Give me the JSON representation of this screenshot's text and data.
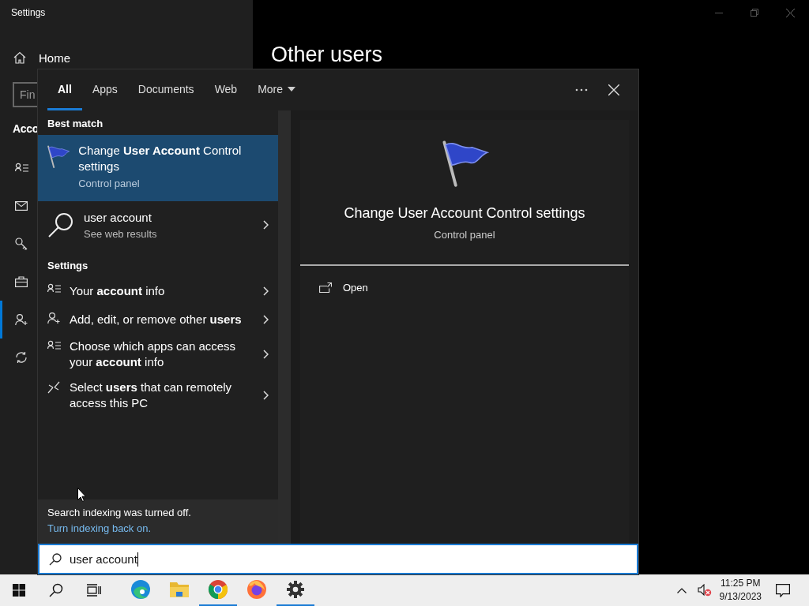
{
  "window": {
    "title": "Settings"
  },
  "sidebar": {
    "home": "Home",
    "search": {
      "placeholder": "Fin"
    },
    "section": "Acco",
    "items": [
      {
        "kind": "contact",
        "selected": false
      },
      {
        "kind": "mail",
        "selected": false
      },
      {
        "kind": "key",
        "selected": false
      },
      {
        "kind": "briefcase",
        "selected": false
      },
      {
        "kind": "person-add",
        "selected": true
      },
      {
        "kind": "sync",
        "selected": false
      }
    ]
  },
  "page": {
    "heading": "Other users"
  },
  "search_flyout": {
    "tabs": [
      {
        "label": "All",
        "selected": true
      },
      {
        "label": "Apps",
        "selected": false
      },
      {
        "label": "Documents",
        "selected": false
      },
      {
        "label": "Web",
        "selected": false
      }
    ],
    "more": "More",
    "best_match_heading": "Best match",
    "best_match": {
      "title": "Change **User Account** Control settings",
      "subtitle": "Control panel",
      "selected": true
    },
    "web_result": {
      "title": "user account",
      "subtitle": "See web results"
    },
    "settings_heading": "Settings",
    "settings": [
      {
        "kind": "contact",
        "label": "Your **account** info"
      },
      {
        "kind": "person-add",
        "label": "Add, edit, or remove other **users**"
      },
      {
        "kind": "contact",
        "label": "Choose which apps can access your **account** info"
      },
      {
        "kind": "remote",
        "label": "Select **users** that can remotely access this PC"
      }
    ],
    "notice": {
      "text": "Search indexing was turned off.",
      "link": "Turn indexing back on."
    },
    "preview": {
      "title": "Change User Account Control settings",
      "subtitle": "Control panel",
      "actions": [
        {
          "kind": "open",
          "label": "Open"
        }
      ]
    },
    "query": "user account"
  },
  "taskbar": {
    "apps": [
      {
        "kind": "edge",
        "running": false
      },
      {
        "kind": "explorer",
        "running": false
      },
      {
        "kind": "chrome",
        "running": true
      },
      {
        "kind": "firefox",
        "running": false
      },
      {
        "kind": "settings",
        "running": true
      }
    ],
    "clock": {
      "time": "11:25 PM",
      "date": "9/13/2023"
    }
  }
}
